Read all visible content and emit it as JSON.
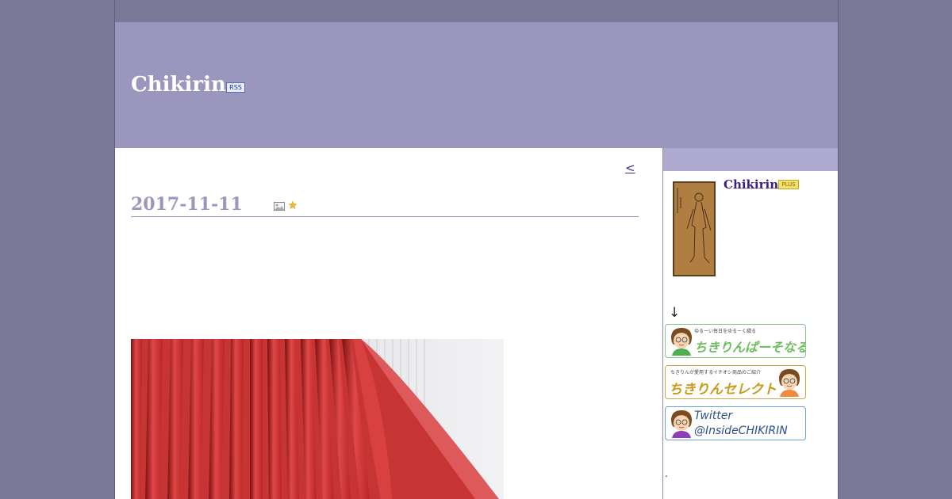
{
  "header": {
    "site_title": "Chikirin",
    "rss_label": "RSS"
  },
  "main": {
    "prev_link": "<",
    "entry_date": "2017-11-11"
  },
  "sidebar": {
    "profile_name": "Chikirin",
    "plus_badge": "PLUS",
    "arrow": "↓",
    "banners": [
      {
        "sub": "ゆるーい毎日をゆるーく綴る",
        "main": "ちきりんぱーそなる"
      },
      {
        "sub": "ちきりんが愛用するイチオシ商品のご紹介",
        "main": "ちきりんセレクト"
      },
      {
        "line1": "Twitter",
        "line2": "@InsideCHIKIRIN"
      }
    ],
    "dot": "."
  },
  "colors": {
    "background": "#7b7898",
    "header": "#9a96bd",
    "sidebar_head": "#aeaad0",
    "date": "#9a96bd",
    "link": "#3a2a8a"
  },
  "icons": [
    "rss-icon",
    "photo-icon",
    "star-icon"
  ]
}
